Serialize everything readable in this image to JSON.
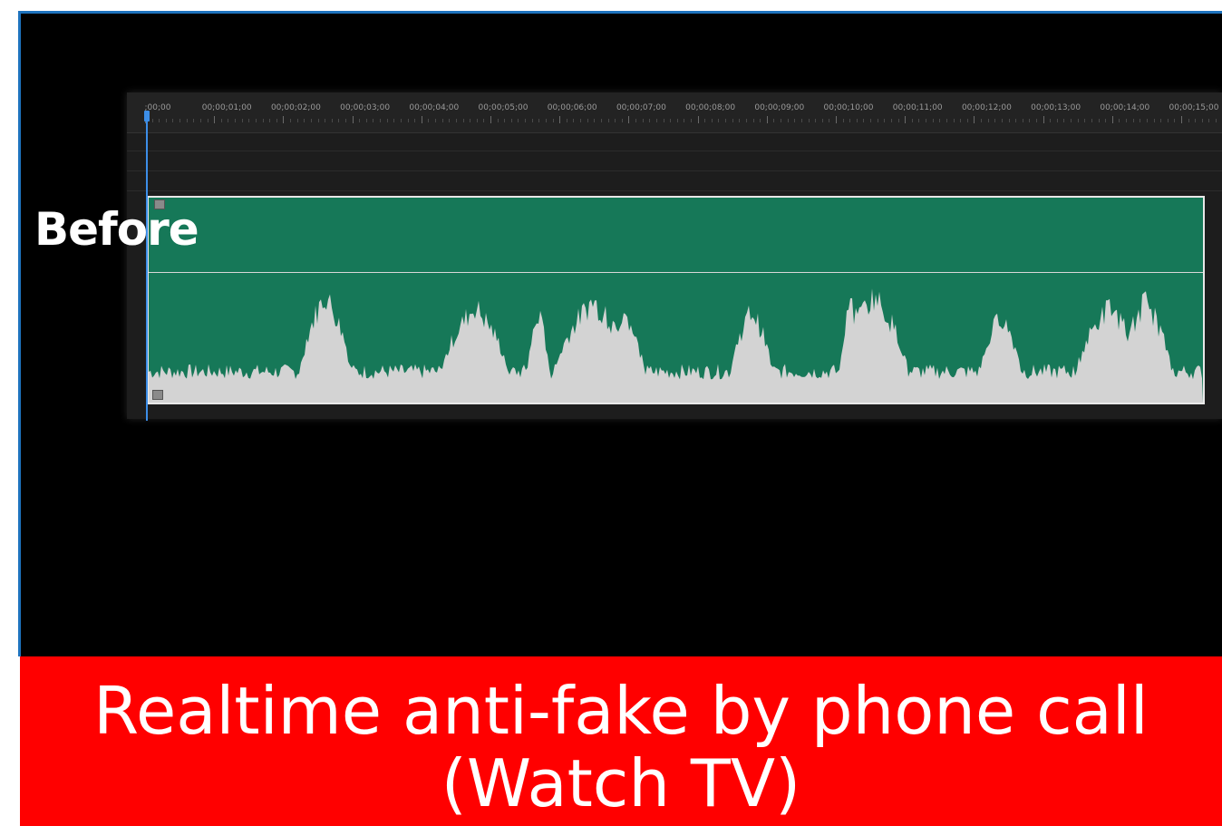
{
  "overlay": {
    "before_label": "Before"
  },
  "timeline": {
    "ruler_labels": [
      ";00;00",
      "00;00;01;00",
      "00;00;02;00",
      "00;00;03;00",
      "00;00;04;00",
      "00;00;05;00",
      "00;00;06;00",
      "00;00;07;00",
      "00;00;08;00",
      "00;00;09;00",
      "00;00;10;00",
      "00;00;11;00",
      "00;00;12;00",
      "00;00;13;00",
      "00;00;14;00",
      "00;00;15;00"
    ],
    "clip_color": "#167858",
    "waveform_color": "#d3d3d3",
    "playhead_color": "#3c8ee8"
  },
  "banner": {
    "line1": "Realtime anti-fake by phone call",
    "line2": "(Watch TV)",
    "background": "#ff0000",
    "text_color": "#ffffff"
  }
}
